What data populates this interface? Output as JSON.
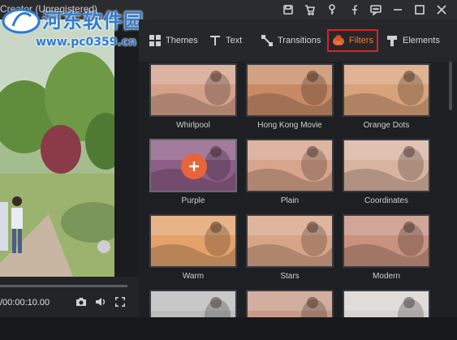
{
  "window": {
    "title": "Creator (Unregistered)",
    "icons": [
      "save-icon",
      "cart-icon",
      "key-icon",
      "facebook-icon",
      "feedback-icon",
      "minimize-icon",
      "maximize-icon",
      "close-icon"
    ]
  },
  "watermark": {
    "title": "河东软件园",
    "url": "www.pc0359.cn"
  },
  "tabs": [
    {
      "label": "Themes",
      "icon": "themes-icon"
    },
    {
      "label": "Text",
      "icon": "text-icon"
    },
    {
      "label": "Transitions",
      "icon": "transitions-icon"
    },
    {
      "label": "Filters",
      "icon": "filters-icon",
      "active": true
    },
    {
      "label": "Elements",
      "icon": "elements-icon"
    }
  ],
  "player": {
    "time": "/00:00:10.00",
    "icons": [
      "snapshot-icon",
      "volume-icon",
      "fullscreen-icon"
    ]
  },
  "filters": [
    {
      "name": "Whirlpool",
      "color": "#d4a08a"
    },
    {
      "name": "Hong Kong Movie",
      "color": "#c98a66"
    },
    {
      "name": "Orange Dots",
      "color": "#d9a27a"
    },
    {
      "name": "Purple",
      "color": "#8e5e86",
      "selected": true
    },
    {
      "name": "Plain",
      "color": "#d7a48c"
    },
    {
      "name": "Coordinates",
      "color": "#d9b5a0"
    },
    {
      "name": "Warm",
      "color": "#e3a26a"
    },
    {
      "name": "Stars",
      "color": "#d8a587"
    },
    {
      "name": "Modern",
      "color": "#c8927e"
    },
    {
      "name": "",
      "color": "#bdbdbd"
    },
    {
      "name": "",
      "color": "#c79b88"
    },
    {
      "name": "",
      "color": "#d8d4d0"
    }
  ],
  "accent": "#f07a3b"
}
